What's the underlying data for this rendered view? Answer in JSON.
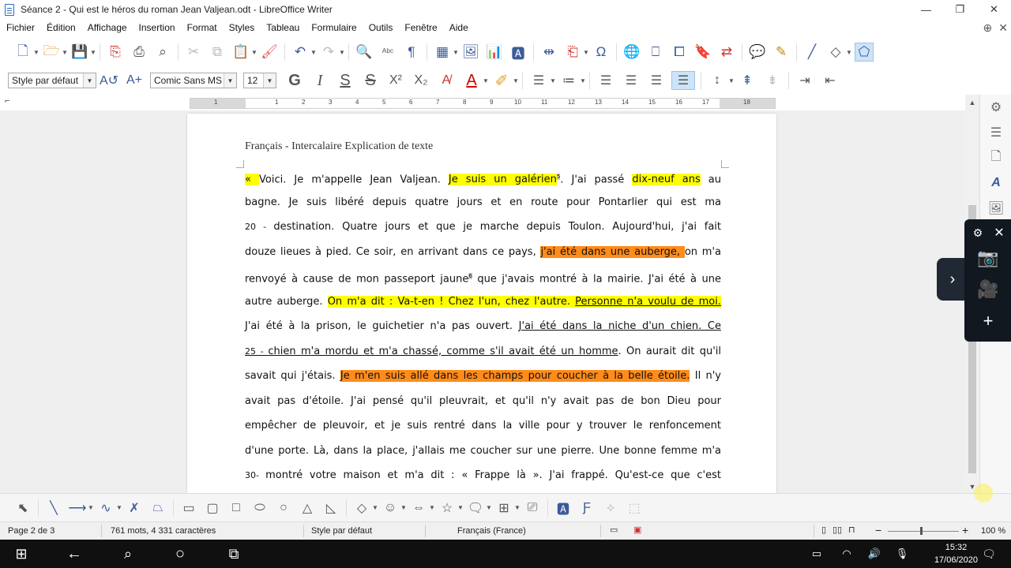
{
  "window": {
    "title": "Séance 2 - Qui est le héros du roman Jean Valjean.odt - LibreOffice Writer",
    "minimize": "—",
    "maximize": "❐",
    "close": "✕"
  },
  "menu": [
    "Fichier",
    "Édition",
    "Affichage",
    "Insertion",
    "Format",
    "Styles",
    "Tableau",
    "Formulaire",
    "Outils",
    "Fenêtre",
    "Aide"
  ],
  "formatting": {
    "paragraph_style": "Style par défaut",
    "font_name": "Comic Sans MS",
    "font_size": "12",
    "bold": "G",
    "italic": "I",
    "underline": "S",
    "strike": "S",
    "superscript": "X²",
    "subscript": "X₂"
  },
  "ruler": {
    "labels": [
      "1",
      "1",
      "2",
      "3",
      "4",
      "5",
      "6",
      "7",
      "8",
      "9",
      "10",
      "11",
      "12",
      "13",
      "14",
      "15",
      "16",
      "17",
      "18"
    ]
  },
  "document": {
    "header": "Français - Intercalaire Explication de texte",
    "lines": [
      [
        {
          "t": "« ",
          "h": "y"
        },
        {
          "t": " Voici. Je m'appelle Jean Valjean. "
        },
        {
          "t": "Je suis un galérien",
          "h": "y"
        },
        {
          "t": "5",
          "fn": true
        },
        {
          "t": ". J'ai passé "
        },
        {
          "t": "dix-neuf ans",
          "h": "y"
        },
        {
          "t": " au"
        }
      ],
      [
        {
          "t": "bagne. Je suis libéré depuis quatre jours et en route pour Pontarlier qui est ma"
        }
      ],
      [
        {
          "t": "20 - ",
          "ln": true
        },
        {
          "t": "destination. Quatre jours et que je marche depuis Toulon. Aujourd'hui, j'ai fait"
        }
      ],
      [
        {
          "t": "douze lieues à pied. Ce soir, en arrivant dans ce pays, "
        },
        {
          "t": "j'ai été dans une auberge, ",
          "h": "o"
        },
        {
          "t": "on m'a"
        }
      ],
      [
        {
          "t": "renvoyé à cause de mon passeport jaune"
        },
        {
          "t": "6",
          "fn": true
        },
        {
          "t": " que j'avais montré à la mairie.  J'ai été à une"
        }
      ],
      [
        {
          "t": "autre auberge. "
        },
        {
          "t": "On m'a dit : Va-t-en ! Chez l'un, chez l'autre. ",
          "h": "y"
        },
        {
          "t": "Personne n'a voulu de moi.",
          "h": "y",
          "u": true
        }
      ],
      [
        {
          "t": "J'ai été à la prison, le guichetier n'a pas ouvert. "
        },
        {
          "t": "J'ai été dans la niche d'un chien. Ce ",
          "u": true
        }
      ],
      [
        {
          "t": "25 - ",
          "ln": true,
          "u": true
        },
        {
          "t": "chien m'a mordu et m'a chassé, comme s'il avait été un homme",
          "u": true
        },
        {
          "t": ". On aurait dit qu'il"
        }
      ],
      [
        {
          "t": "savait qui j'étais. "
        },
        {
          "t": "Je m'en suis allé dans les champs pour coucher à la belle étoile.",
          "h": "o"
        },
        {
          "t": " Il n'y"
        }
      ],
      [
        {
          "t": "avait pas d'étoile. J'ai pensé qu'il pleuvrait, et qu'il n'y avait pas de bon Dieu pour"
        }
      ],
      [
        {
          "t": "empêcher de pleuvoir, et je suis rentré dans la ville pour y trouver le renfoncement"
        }
      ],
      [
        {
          "t": "d'une porte. Là, dans la place, j'allais me coucher sur une pierre. Une bonne femme m'a"
        }
      ],
      [
        {
          "t": "30- ",
          "ln": true
        },
        {
          "t": "montré votre maison et m'a dit : « Frappe là ». J'ai frappé. Qu'est-ce que c'est"
        }
      ]
    ]
  },
  "status": {
    "page": "Page 2 de 3",
    "words": "761 mots, 4 331 caractères",
    "style": "Style par défaut",
    "language": "Français (France)",
    "zoom": "100 %"
  },
  "taskbar": {
    "time": "15:32",
    "date": "17/06/2020"
  },
  "colors": {
    "highlight_yellow": "#ffff00",
    "highlight_orange": "#ff8c1a",
    "accent": "#3b5b9a"
  }
}
